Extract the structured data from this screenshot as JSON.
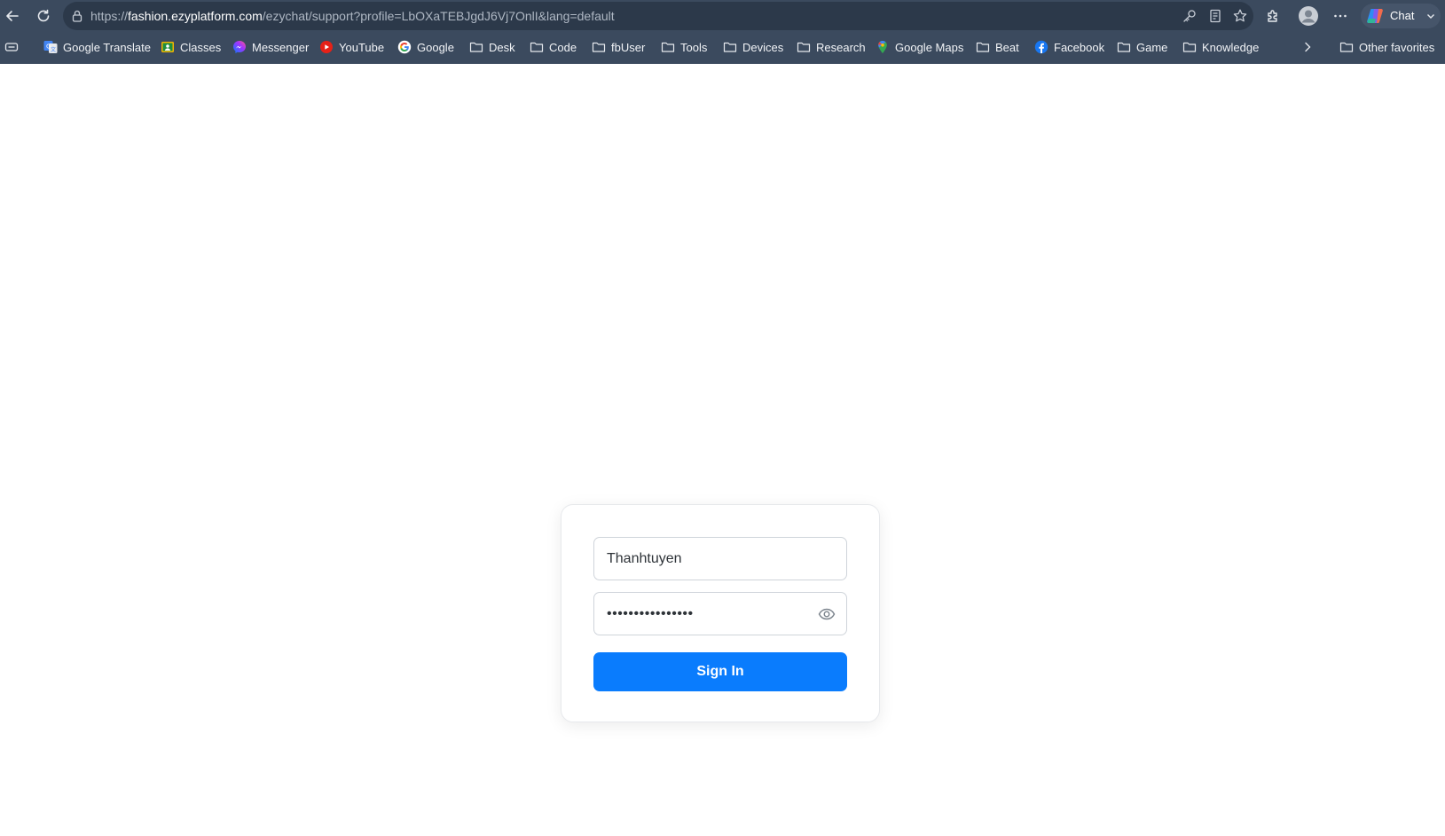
{
  "browser": {
    "url_scheme": "https://",
    "url_host": "fashion.ezyplatform.com",
    "url_path": "/ezychat/support?profile=LbOXaTEBJgdJ6Vj7OnlI&lang=default",
    "chat_label": "Chat",
    "icons": [
      "back-icon",
      "refresh-icon",
      "lock-icon",
      "key-icon",
      "reading-mode-icon",
      "star-icon",
      "extensions-icon",
      "profile-icon",
      "more-icon",
      "copilot-icon",
      "chevron-down-icon"
    ]
  },
  "bookmarks": {
    "items": [
      {
        "label": "Google Translate",
        "icon": "google-translate-icon"
      },
      {
        "label": "Classes",
        "icon": "classes-icon"
      },
      {
        "label": "Messenger",
        "icon": "messenger-icon"
      },
      {
        "label": "YouTube",
        "icon": "youtube-icon"
      },
      {
        "label": "Google",
        "icon": "google-icon"
      },
      {
        "label": "Desk",
        "icon": "folder-icon"
      },
      {
        "label": "Code",
        "icon": "folder-icon"
      },
      {
        "label": "fbUser",
        "icon": "folder-icon"
      },
      {
        "label": "Tools",
        "icon": "folder-icon"
      },
      {
        "label": "Devices",
        "icon": "folder-icon"
      },
      {
        "label": "Research",
        "icon": "folder-icon"
      },
      {
        "label": "Google Maps",
        "icon": "google-maps-icon"
      },
      {
        "label": "Beat",
        "icon": "folder-icon"
      },
      {
        "label": "Facebook",
        "icon": "facebook-icon"
      },
      {
        "label": "Game",
        "icon": "folder-icon"
      },
      {
        "label": "Knowledge",
        "icon": "folder-icon"
      }
    ],
    "other_favorites": "Other favorites"
  },
  "login": {
    "username_value": "Thanhtuyen",
    "password_value": "••••••••••••••••",
    "signin_label": "Sign In",
    "button_color": "#0a7cfd"
  }
}
